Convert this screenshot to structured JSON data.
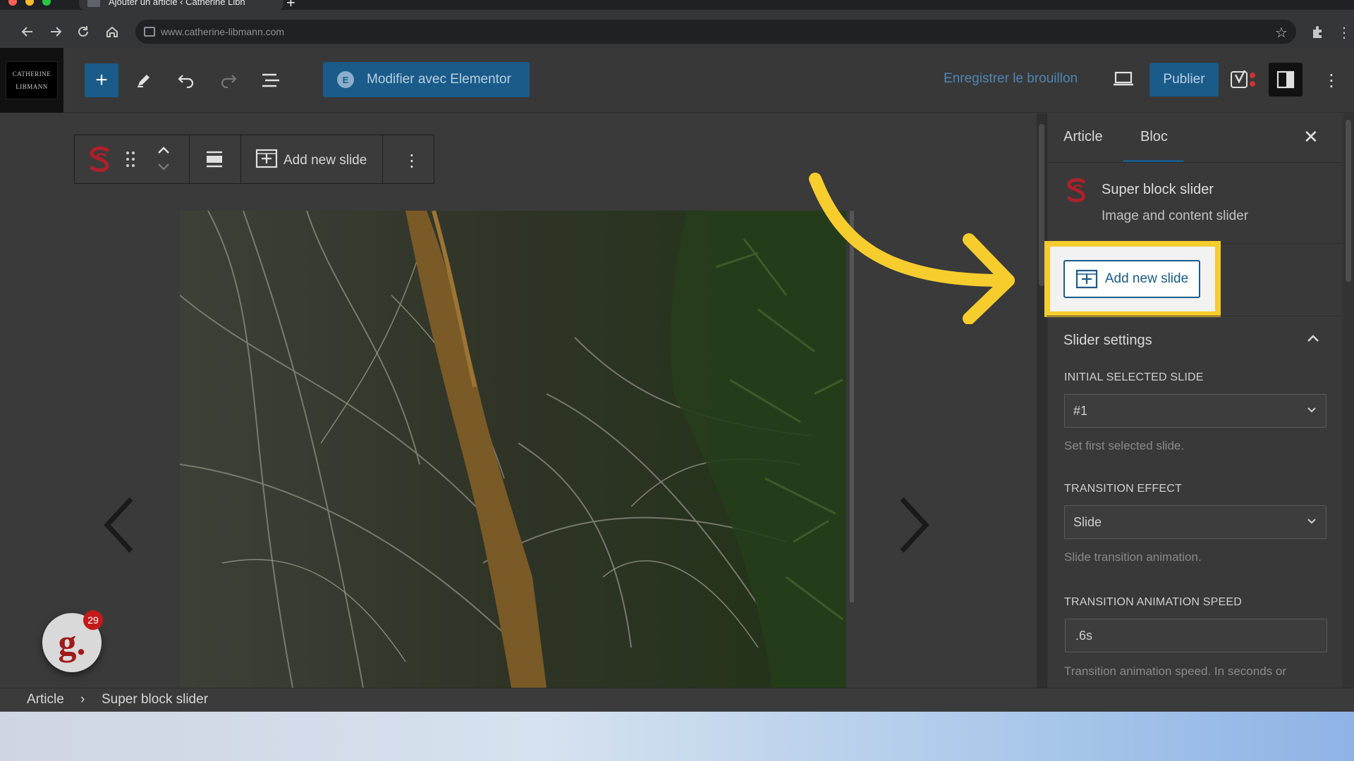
{
  "browser": {
    "tab_title": "Ajouter un article ‹ Catherine Libn",
    "url": "www.catherine-libmann.com",
    "new_tab": "+"
  },
  "header": {
    "logo_lines": [
      "CATHERINE",
      "LIBMANN"
    ],
    "add_block": "+",
    "elementor_badge": "E",
    "elementor_button": "Modifier avec Elementor",
    "save_draft": "Enregistrer le brouillon",
    "publish": "Publier"
  },
  "block_toolbar": {
    "add_new_slide": "Add new slide"
  },
  "slider": {
    "prev_arrow": "‹",
    "next_arrow": "›"
  },
  "sidebar": {
    "tabs": [
      {
        "label": "Article",
        "active": false
      },
      {
        "label": "Bloc",
        "active": true
      }
    ],
    "close": "✕",
    "block_name": "Super block slider",
    "block_description": "Image and content slider",
    "add_new_slide": "Add new slide",
    "section_title": "Slider settings",
    "fields": {
      "initial_slide": {
        "label": "Initial selected slide",
        "value": "#1",
        "help": "Set first selected slide."
      },
      "transition_effect": {
        "label": "Transition effect",
        "value": "Slide",
        "help": "Slide transition animation."
      },
      "transition_speed": {
        "label": "Transition animation speed",
        "value": ".6s",
        "help": "Transition animation speed. In seconds or"
      }
    }
  },
  "breadcrumb": {
    "items": [
      "Article",
      "Super block slider"
    ],
    "separator": "›"
  },
  "grammarly": {
    "letter": "g.",
    "count": "29"
  },
  "colors": {
    "accent": "#1a5b89",
    "highlight": "#f7cd2e",
    "overlay_bg": "#3a3a3a"
  }
}
